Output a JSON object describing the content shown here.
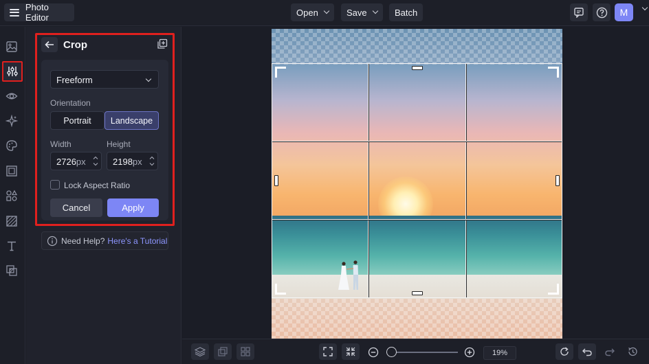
{
  "app": {
    "title": "Photo Editor"
  },
  "topbar": {
    "open_label": "Open",
    "save_label": "Save",
    "batch_label": "Batch",
    "avatar_initial": "M"
  },
  "crop_panel": {
    "title": "Crop",
    "ratio_select": "Freeform",
    "orientation_label": "Orientation",
    "orientation_options": [
      "Portrait",
      "Landscape"
    ],
    "orientation_selected": "Landscape",
    "width_label": "Width",
    "height_label": "Height",
    "width_value": "2726",
    "height_value": "2198",
    "unit": "px",
    "lock_label": "Lock Aspect Ratio",
    "lock_checked": false,
    "cancel_label": "Cancel",
    "apply_label": "Apply"
  },
  "help": {
    "text": "Need Help?",
    "link": "Here's a Tutorial"
  },
  "zoom": {
    "value": "19%"
  },
  "colors": {
    "accent": "#7d86f5",
    "highlight": "#e0201e",
    "background": "#1b1d26"
  },
  "icons": {
    "rail": [
      "image-icon",
      "adjustments-icon",
      "eye-icon",
      "sparkles-icon",
      "palette-icon",
      "frame-icon",
      "shapes-icon",
      "texture-icon",
      "text-icon",
      "overlay-icon"
    ],
    "bottom": [
      "layers-icon",
      "transform-icon",
      "grid-icon",
      "fit-screen-icon",
      "collapse-icon",
      "zoom-out-icon",
      "zoom-in-icon",
      "reset-icon",
      "undo-icon",
      "redo-icon",
      "history-icon"
    ]
  }
}
